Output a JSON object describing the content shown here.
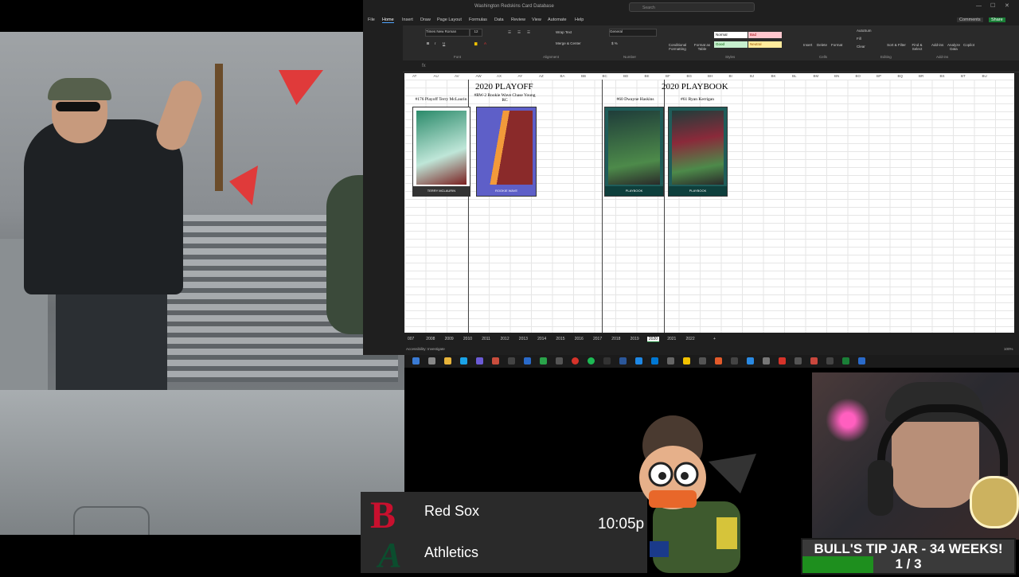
{
  "excel": {
    "app_title": "Washington Redskins Card Database",
    "search_placeholder": "Search",
    "menus": [
      "File",
      "Home",
      "Insert",
      "Draw",
      "Page Layout",
      "Formulas",
      "Data",
      "Review",
      "View",
      "Automate",
      "Help"
    ],
    "comments_label": "Comments",
    "share_label": "Share",
    "ribbon": {
      "font_name": "Times New Roman",
      "font_size": "12",
      "wrap_text": "Wrap Text",
      "merge_center": "Merge & Center",
      "number_format": "General",
      "conditional_formatting": "Conditional Formatting",
      "format_as_table": "Format as Table",
      "styles": {
        "normal": "Normal",
        "bad": "Bad",
        "good": "Good",
        "neutral": "Neutral"
      },
      "insert": "Insert",
      "delete": "Delete",
      "format": "Format",
      "autosum": "AutoSum",
      "fill": "Fill",
      "clear": "Clear",
      "sort_filter": "Sort & Filter",
      "find_select": "Find & Select",
      "addins": "Add-ins",
      "analyze": "Analyze Data",
      "copilot": "Copilot",
      "groups": [
        "Font",
        "Alignment",
        "Number",
        "Styles",
        "Cells",
        "Editing",
        "Add-ins"
      ]
    },
    "columns": [
      "AT",
      "AU",
      "AV",
      "AW",
      "AX",
      "AY",
      "AZ",
      "BA",
      "BB",
      "BC",
      "BD",
      "BE",
      "BF",
      "BG",
      "BH",
      "BI",
      "BJ",
      "BK",
      "BL",
      "BM",
      "BN",
      "BO",
      "BP",
      "BQ",
      "BR",
      "BS",
      "BT",
      "BU"
    ],
    "section_titles": [
      "2020 PLAYOFF",
      "2020 PLAYBOOK"
    ],
    "cards": [
      {
        "caption": "#176 Playoff Terry McLaurin",
        "foot": "TERRY MCLAURIN",
        "color": "#2a8a6a"
      },
      {
        "caption": "#RW-2 Rookie Wave Chase Young RC",
        "foot": "ROOKIE WAVE",
        "color": "#5e5fc8"
      },
      {
        "caption": "#60 Dwayne Haskins",
        "foot": "PLAYBOOK",
        "color": "#1f5d5a"
      },
      {
        "caption": "#61 Ryan Kerrigan",
        "foot": "PLAYBOOK",
        "color": "#1f5d5a"
      }
    ],
    "sheet_tabs": [
      "007",
      "2008",
      "2009",
      "2010",
      "2011",
      "2012",
      "2013",
      "2014",
      "2015",
      "2016",
      "2017",
      "2018",
      "2019",
      "2020",
      "2021",
      "2022"
    ],
    "active_tab": "2020",
    "status_text": "Accessibility: Investigate",
    "zoom": "100%"
  },
  "scoreboard": {
    "team1": "Red Sox",
    "team2": "Athletics",
    "time": "10:05p"
  },
  "tipjar": {
    "title": "BULL'S TIP JAR - 34 WEEKS!",
    "count": "1 / 3",
    "progress": 0.333
  }
}
